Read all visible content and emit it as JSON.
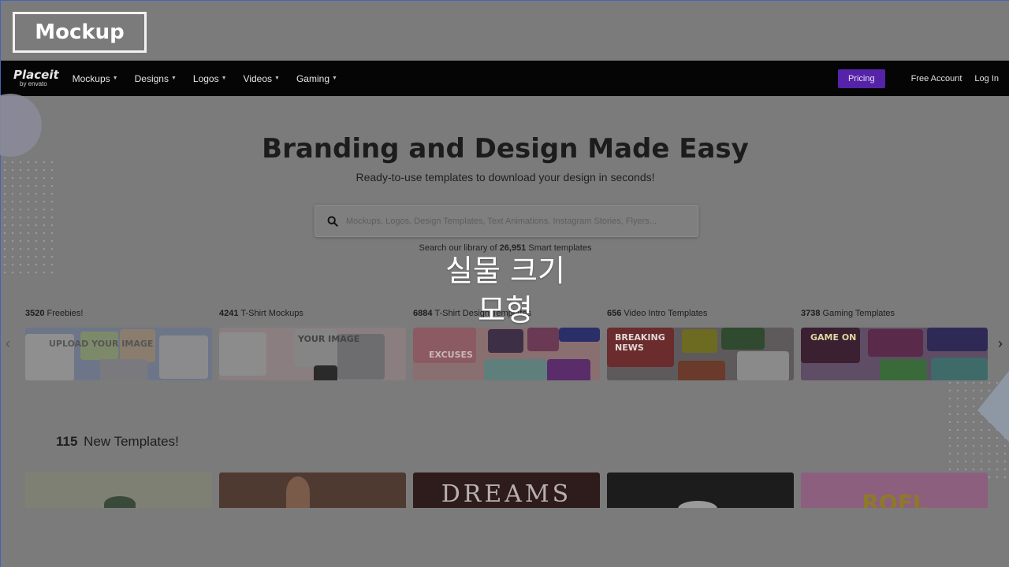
{
  "caption": {
    "label": "Mockup"
  },
  "navbar": {
    "logo_main": "Placeit",
    "logo_sub": "by envato",
    "items": [
      {
        "label": "Mockups"
      },
      {
        "label": "Designs"
      },
      {
        "label": "Logos"
      },
      {
        "label": "Videos"
      },
      {
        "label": "Gaming"
      }
    ],
    "pricing": "Pricing",
    "free_account": "Free Account",
    "login": "Log In"
  },
  "hero": {
    "title": "Branding and Design Made Easy",
    "subtitle": "Ready-to-use templates to download your design in seconds!",
    "search_placeholder": "Mockups, Logos, Design Templates, Text Animations, Instagram Stories, Flyers...",
    "note_prefix": "Search our library of ",
    "note_count": "26,951",
    "note_suffix": " Smart templates"
  },
  "overlay": {
    "line1": "실물 크기",
    "line2": "모형"
  },
  "categories": [
    {
      "count": "3520",
      "label": " Freebies!",
      "color": "#6d7688"
    },
    {
      "count": "4241",
      "label": " T-Shirt Mockups",
      "color": "#8a7e80"
    },
    {
      "count": "6884",
      "label": " T-Shirt Design Templates",
      "color": "#8a6f70"
    },
    {
      "count": "656",
      "label": " Video Intro Templates",
      "color": "#5e5a5c"
    },
    {
      "count": "3738",
      "label": " Gaming Templates",
      "color": "#5e4d64"
    }
  ],
  "category_art_text": {
    "c1": "UPLOAD YOUR IMAGE",
    "c2": "YOUR IMAGE",
    "c3": "EXCUSES",
    "c4": "BREAKING NEWS",
    "c5": "GAME ON"
  },
  "new_section": {
    "count": "115",
    "label": "New Templates!"
  },
  "new_cards": {
    "card3_text": "DREAMS",
    "card5_text": "ROFL"
  },
  "icons": {
    "search": "search-icon",
    "prev": "chevron-left-icon",
    "next": "chevron-right-icon"
  }
}
